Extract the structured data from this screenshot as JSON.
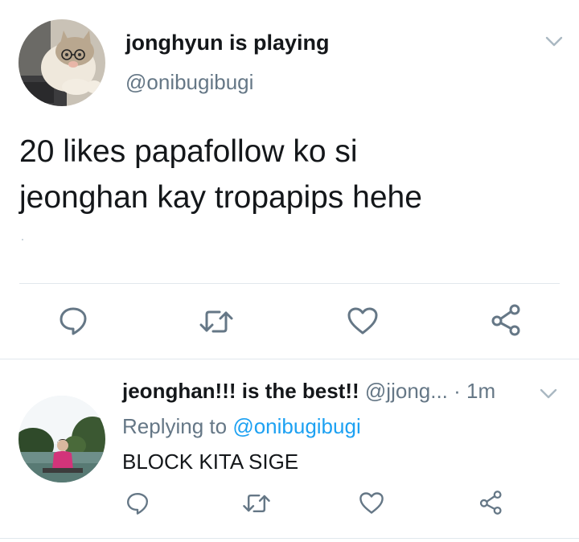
{
  "main_tweet": {
    "display_name": "jonghyun is playing",
    "handle": "@onibugibugi",
    "text_lines": [
      "20 likes papafollow ko si",
      "jeonghan kay tropapips hehe"
    ],
    "avatar_icon": "cat-with-glasses-avatar",
    "actions": [
      {
        "name": "reply",
        "icon": "reply-icon"
      },
      {
        "name": "retweet",
        "icon": "retweet-icon"
      },
      {
        "name": "like",
        "icon": "heart-icon"
      },
      {
        "name": "share",
        "icon": "share-icon"
      }
    ]
  },
  "reply_tweet": {
    "display_name": "jeonghan!!! is the best!!",
    "handle": "@jjong...",
    "separator": "·",
    "timestamp": "1m",
    "replying_prefix": "Replying to",
    "replying_handle": "@onibugibugi",
    "text": "BLOCK KITA SIGE",
    "avatar_icon": "person-outdoors-avatar"
  },
  "colors": {
    "text_primary": "#14171a",
    "text_secondary": "#657786",
    "link_blue": "#1da1f2",
    "icon_gray": "#657786",
    "divider": "#e1e8ed"
  }
}
